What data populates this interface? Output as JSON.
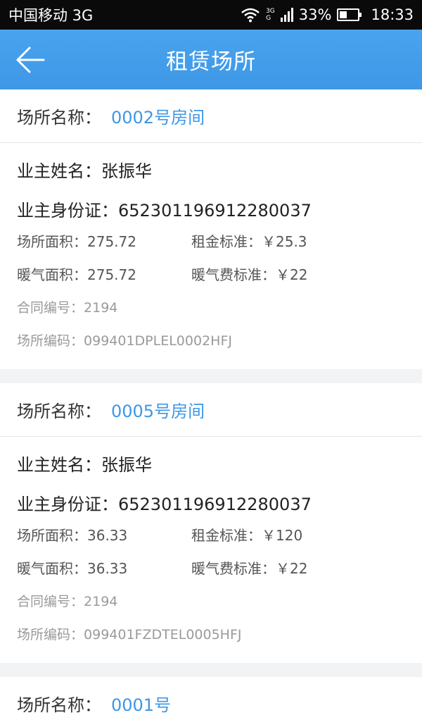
{
  "status_bar": {
    "carrier": "中国移动 3G",
    "network_badge_top": "3G",
    "network_badge_bottom": "G",
    "battery_percent": "33%",
    "battery_level": 0.33,
    "time": "18:33",
    "icons": [
      "wifi-icon",
      "signal-icon",
      "battery-icon"
    ]
  },
  "app_bar": {
    "title": "租赁场所",
    "back_icon": "arrow-left-icon"
  },
  "labels": {
    "place_name": "场所名称：",
    "owner_name": "业主姓名：",
    "owner_id": "业主身份证：",
    "area": "场所面积：",
    "rent_standard": "租金标准：",
    "heating_area": "暖气面积：",
    "heating_fee_standard": "暖气费标准：",
    "contract_no": "合同编号：",
    "place_code": "场所编码："
  },
  "cards": [
    {
      "place_name": "0002号房间",
      "owner_name": "张振华",
      "owner_id": "652301196912280037",
      "area": "275.72",
      "rent_standard": "￥25.3",
      "heating_area": "275.72",
      "heating_fee_standard": "￥22",
      "contract_no": "2194",
      "place_code": "099401DPLEL0002HFJ"
    },
    {
      "place_name": "0005号房间",
      "owner_name": "张振华",
      "owner_id": "652301196912280037",
      "area": "36.33",
      "rent_standard": "￥120",
      "heating_area": "36.33",
      "heating_fee_standard": "￥22",
      "contract_no": "2194",
      "place_code": "099401FZDTEL0005HFJ"
    },
    {
      "place_name": "0001号"
    }
  ],
  "colors": {
    "app_bar": "#3e98e6",
    "link_blue": "#3d97e8",
    "status_bar": "#0a0a0a",
    "background": "#f2f3f5"
  }
}
